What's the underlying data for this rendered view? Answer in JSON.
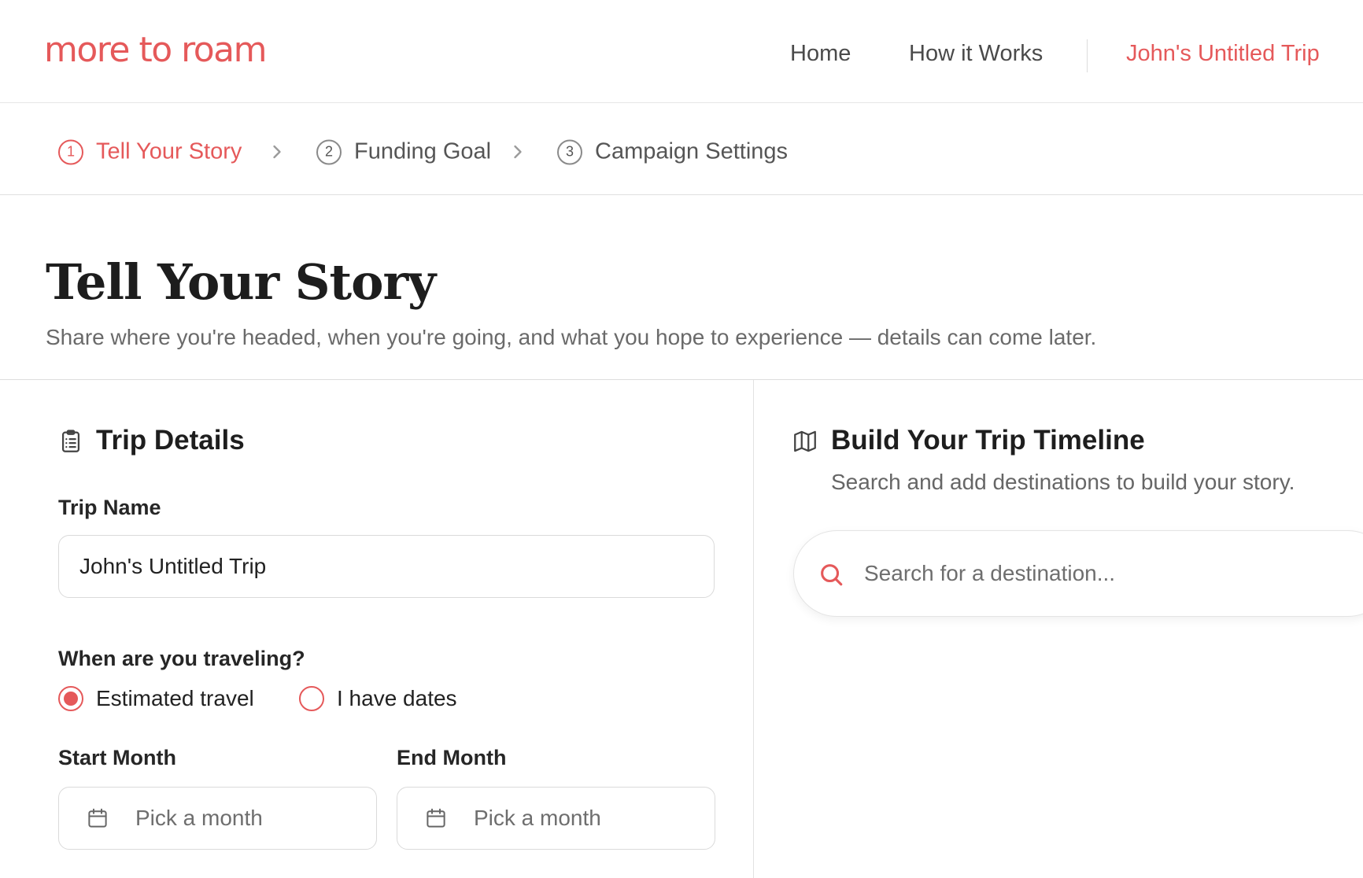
{
  "brand": {
    "logo_text": "more to roam",
    "accent": "#e5595a"
  },
  "nav": {
    "home": "Home",
    "how_it_works": "How it Works",
    "current_trip": "John's Untitled Trip"
  },
  "stepper": {
    "steps": [
      {
        "number": "1",
        "label": "Tell Your Story",
        "active": true
      },
      {
        "number": "2",
        "label": "Funding Goal",
        "active": false
      },
      {
        "number": "3",
        "label": "Campaign Settings",
        "active": false
      }
    ]
  },
  "page": {
    "title": "Tell Your Story",
    "subtitle": "Share where you're headed, when you're going, and what you hope to experience — details can come later."
  },
  "trip_details": {
    "icon": "clipboard-icon",
    "title": "Trip Details",
    "trip_name_label": "Trip Name",
    "trip_name_value": "John's Untitled Trip",
    "when_label": "When are you traveling?",
    "options": {
      "estimated": "Estimated travel",
      "dates": "I have dates"
    },
    "selected_option": "estimated",
    "start_month_label": "Start Month",
    "end_month_label": "End Month",
    "month_placeholder": "Pick a month"
  },
  "timeline": {
    "icon": "map-icon",
    "title": "Build Your Trip Timeline",
    "subtitle": "Search and add destinations to build your story.",
    "search_placeholder": "Search for a destination..."
  }
}
